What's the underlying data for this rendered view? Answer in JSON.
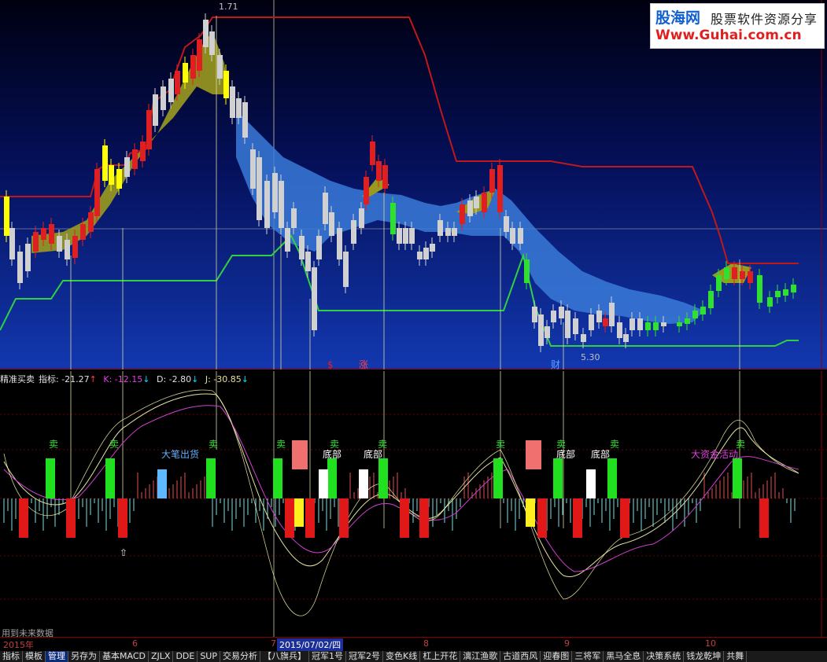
{
  "logo": {
    "brand": "股海网",
    "slogan": "股票软件资源分享",
    "url": "Www.Guhai.com.cn"
  },
  "price_labels": {
    "high": "1.71",
    "low": "5.30",
    "markers": [
      "$",
      "涨",
      "财"
    ]
  },
  "indicator_header": {
    "name": "精准买卖",
    "zhibiao": "指标: -21.27",
    "k": "K: -12.15",
    "d": "D: -2.80",
    "j": "J: -30.85"
  },
  "signals": {
    "sell": "卖",
    "bottom": "底部",
    "big_selloff": "大笔出货",
    "big_money": "大资金活动"
  },
  "future_note": "用到未来数据",
  "date_axis": {
    "year": "2015年",
    "months": [
      "6",
      "7",
      "8",
      "9",
      "10"
    ],
    "cursor_date": "2015/07/02/四"
  },
  "tabs": [
    "指标",
    "模板",
    "管理",
    "另存为",
    "基本MACD",
    "ZJLX",
    "DDE",
    "SUP",
    "交易分析",
    "【八旗兵】",
    "冠军1号",
    "冠军2号",
    "变色K线",
    "杠上开花",
    "漓江渔歌",
    "古道西风",
    "迎春图",
    "三将军",
    "黑马全息",
    "决策系统",
    "钱龙乾坤",
    "共舞"
  ],
  "active_tab": "管理",
  "colors": {
    "background": "#000000",
    "up": "#ffff00",
    "down": "#c0c0c0",
    "resistance": "#c01818",
    "support": "#30d040",
    "band": "#3a7ad8",
    "bull_band": "#9a9a20"
  }
}
